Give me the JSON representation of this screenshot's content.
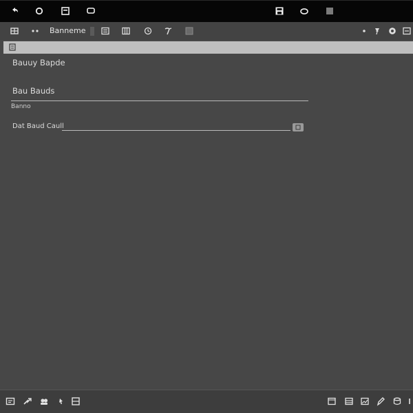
{
  "topbar": {
    "icons": [
      "back-icon",
      "circle-icon",
      "window-icon",
      "chat-icon",
      "save-icon",
      "cloud-icon",
      "stop-icon"
    ]
  },
  "toolbar": {
    "label": "Banneme",
    "icons_left": [
      "grid-icon",
      "more-icon"
    ],
    "icons_mid": [
      "list-icon",
      "columns-icon",
      "history-icon",
      "tool-icon",
      "panel-icon"
    ],
    "icons_right": [
      "dot-icon",
      "pin-icon",
      "globe-icon",
      "menu-icon"
    ]
  },
  "addressbar": {
    "icon": "tab-icon"
  },
  "content": {
    "title": "Bauuy Bapde",
    "field_label": "Bau Bauds",
    "small_label": "Banno",
    "row_label": "Dat Baud Caull"
  },
  "bottombar": {
    "icons_left": [
      "comment-icon",
      "share-icon",
      "people-icon",
      "cursor-icon",
      "list-box-icon"
    ],
    "icons_right": [
      "window-icon",
      "table-icon",
      "image-icon",
      "edit-icon",
      "db-icon",
      "more-vertical-icon"
    ]
  },
  "colors": {
    "background": "#474747",
    "topbar": "#060606",
    "toolbar": "#434343",
    "addressbar": "#bfbfbf",
    "bottombar": "#3d3d3d",
    "text": "#dcdcdc"
  }
}
